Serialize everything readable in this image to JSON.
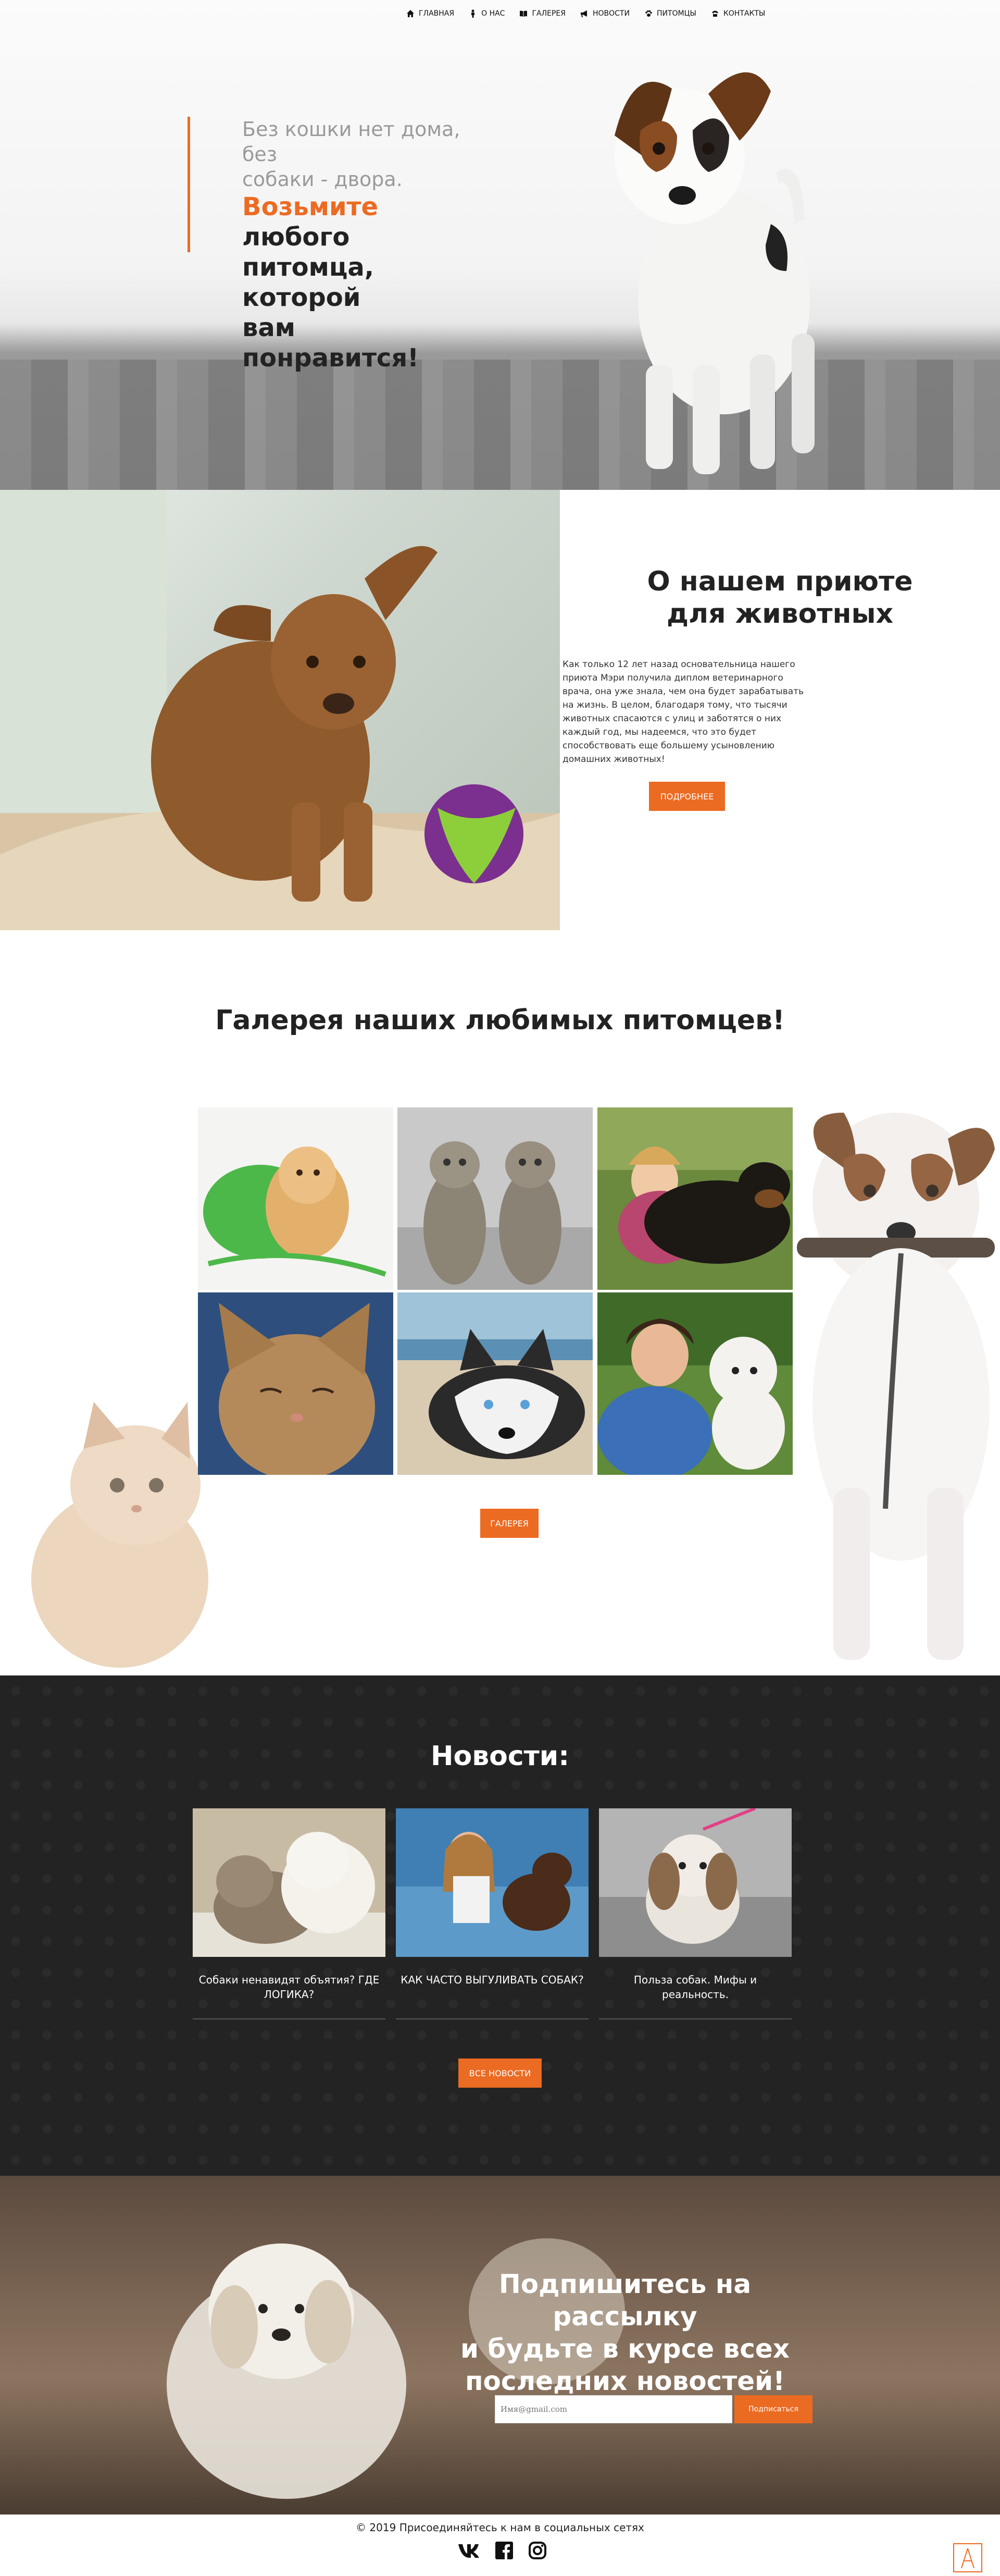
{
  "nav": {
    "items": [
      {
        "label": "Главная",
        "icon": "home-icon"
      },
      {
        "label": "О нас",
        "icon": "person-icon"
      },
      {
        "label": "Галерея",
        "icon": "book-icon"
      },
      {
        "label": "Новости",
        "icon": "megaphone-icon"
      },
      {
        "label": "Питомцы",
        "icon": "paw-icon"
      },
      {
        "label": "Контакты",
        "icon": "phone-icon"
      }
    ]
  },
  "hero": {
    "line1": "Без кошки нет дома, без",
    "line2": "собаки - двора.",
    "highlight": "Возьмите",
    "line3_rest": " любого",
    "line4": "питомца, которой",
    "line5": "вам понравится!"
  },
  "about": {
    "title_line1": "О нашем приюте",
    "title_line2": "для животных",
    "text": "Как только 12 лет назад основательница нашего приюта Мэри получила диплом ветеринарного врача, она уже знала, чем она будет зарабатывать на жизнь. В целом, благодаря тому, что тысячи животных спасаются с улиц и заботятся о них каждый год, мы надеемся, что это будет способствовать еще большему усыновлению домашних животных!",
    "button": "Подробнее"
  },
  "gallery": {
    "title": "Галерея наших любимых питомцев!",
    "button": "Галерея"
  },
  "news": {
    "title": "Новости:",
    "items": [
      {
        "title": "Собаки ненавидят объятия? ГДЕ ЛОГИКА?"
      },
      {
        "title": "КАК ЧАСТО ВЫГУЛИВАТЬ СОБАК?"
      },
      {
        "title": "Польза собак. Мифы и реальность."
      }
    ],
    "button": "Все новости"
  },
  "subscribe": {
    "title_line1": "Подпишитесь на рассылку",
    "title_line2": "и будьте в курсе всех",
    "title_line3": "последних новостей!",
    "placeholder": "Имя@gmail.com",
    "button": "Подписаться"
  },
  "footer": {
    "copy": "© 2019 Присоединяйтесь к нам в социальных сетях",
    "socials": [
      "vk-icon",
      "facebook-icon",
      "instagram-icon"
    ]
  },
  "colors": {
    "accent": "#ec6b22",
    "dark": "#232323"
  }
}
